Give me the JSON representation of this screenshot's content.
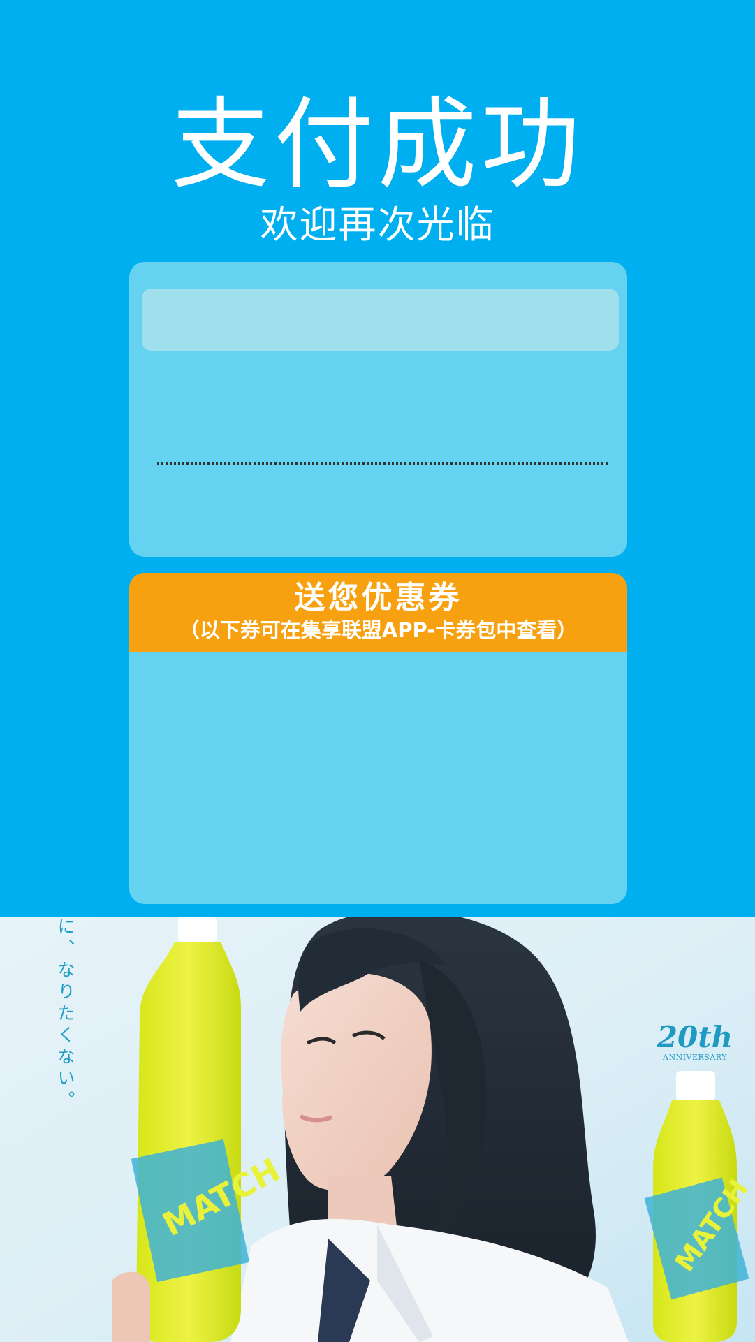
{
  "header": {
    "title": "支付成功",
    "subtitle": "欢迎再次光临"
  },
  "coupon_section": {
    "title": "送您优惠券",
    "note": "（以下券可在集享联盟APP-卡券包中查看）"
  },
  "ad_banner": {
    "vertical_text": "に、なりたくない。",
    "badge_number": "20th",
    "badge_caption": "ANNIVERSARY",
    "product_label": "MATCH"
  },
  "colors": {
    "background": "#00aff0",
    "card": "#66d2f1",
    "coupon_header": "#f7a010"
  }
}
